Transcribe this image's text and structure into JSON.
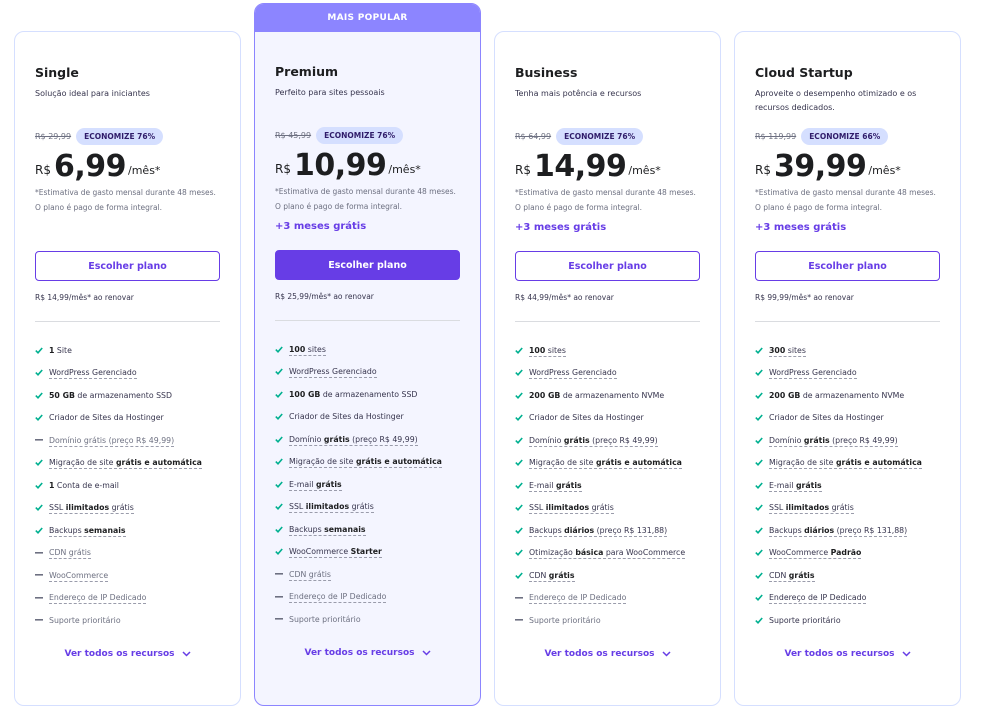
{
  "popular_banner": "MAIS POPULAR",
  "choose_label": "Escolher plano",
  "see_all_label": "Ver todos os recursos",
  "colors": {
    "accent": "#673de6",
    "popular": "#8c85ff",
    "check": "#00b090",
    "dash": "#6d7081",
    "badge": "#d5dfff"
  },
  "plans": [
    {
      "name": "Single",
      "desc": "Solução ideal para iniciantes",
      "old_price": "R$ 29,99",
      "badge": "ECONOMIZE 76%",
      "currency": "R$",
      "amount": "6,99",
      "period": "/mês*",
      "estimate": "*Estimativa de gasto mensal durante 48 meses. O plano é pago de forma integral.",
      "bonus": "",
      "renew": "R$ 14,99/mês* ao renovar",
      "features": [
        {
          "icon": "check",
          "bold": "1",
          "text": " Site",
          "dotted": false
        },
        {
          "icon": "check",
          "text": "WordPress Gerenciado",
          "dotted": true
        },
        {
          "icon": "check",
          "bold": "50 GB",
          "text": " de armazenamento SSD",
          "dotted": false
        },
        {
          "icon": "check",
          "text": "Criador de Sites da Hostinger",
          "dotted": false
        },
        {
          "icon": "dash",
          "text": "Domínio grátis (preço R$ 49,99)",
          "dotted": true
        },
        {
          "icon": "check",
          "text": "Migração de site ",
          "bold_after": "grátis e automática",
          "dotted": true
        },
        {
          "icon": "check",
          "bold": "1",
          "text": " Conta de e-mail",
          "dotted": false
        },
        {
          "icon": "check",
          "text": "SSL ",
          "bold_after": "ilimitados",
          "tail": " grátis",
          "dotted": true
        },
        {
          "icon": "check",
          "text": "Backups ",
          "bold_after": "semanais",
          "dotted": true
        },
        {
          "icon": "dash",
          "text": "CDN grátis",
          "dotted": true
        },
        {
          "icon": "dash",
          "text": "WooCommerce",
          "dotted": true
        },
        {
          "icon": "dash",
          "text": "Endereço de IP Dedicado",
          "dotted": true
        },
        {
          "icon": "dash",
          "text": "Suporte prioritário",
          "dotted": false
        }
      ]
    },
    {
      "name": "Premium",
      "desc": "Perfeito para sites pessoais",
      "old_price": "R$ 45,99",
      "badge": "ECONOMIZE 76%",
      "currency": "R$",
      "amount": "10,99",
      "period": "/mês*",
      "estimate": "*Estimativa de gasto mensal durante 48 meses. O plano é pago de forma integral.",
      "bonus": "+3 meses grátis",
      "renew": "R$ 25,99/mês* ao renovar",
      "features": [
        {
          "icon": "check",
          "bold": "100",
          "text": " sites",
          "dotted": true
        },
        {
          "icon": "check",
          "text": "WordPress Gerenciado",
          "dotted": true
        },
        {
          "icon": "check",
          "bold": "100 GB",
          "text": " de armazenamento SSD",
          "dotted": false
        },
        {
          "icon": "check",
          "text": "Criador de Sites da Hostinger",
          "dotted": false
        },
        {
          "icon": "check",
          "text": "Domínio ",
          "bold_after": "grátis",
          "tail": " (preço R$ 49,99)",
          "dotted": true
        },
        {
          "icon": "check",
          "text": "Migração de site ",
          "bold_after": "grátis e automática",
          "dotted": true
        },
        {
          "icon": "check",
          "text": "E-mail ",
          "bold_after": "grátis",
          "dotted": true
        },
        {
          "icon": "check",
          "text": "SSL ",
          "bold_after": "ilimitados",
          "tail": " grátis",
          "dotted": true
        },
        {
          "icon": "check",
          "text": "Backups ",
          "bold_after": "semanais",
          "dotted": true
        },
        {
          "icon": "check",
          "text": "WooCommerce ",
          "bold_after": "Starter",
          "dotted": true
        },
        {
          "icon": "dash",
          "text": "CDN grátis",
          "dotted": true
        },
        {
          "icon": "dash",
          "text": "Endereço de IP Dedicado",
          "dotted": true
        },
        {
          "icon": "dash",
          "text": "Suporte prioritário",
          "dotted": false
        }
      ]
    },
    {
      "name": "Business",
      "desc": "Tenha mais potência e recursos",
      "old_price": "R$ 64,99",
      "badge": "ECONOMIZE 76%",
      "currency": "R$",
      "amount": "14,99",
      "period": "/mês*",
      "estimate": "*Estimativa de gasto mensal durante 48 meses. O plano é pago de forma integral.",
      "bonus": "+3 meses grátis",
      "renew": "R$ 44,99/mês* ao renovar",
      "features": [
        {
          "icon": "check",
          "bold": "100",
          "text": " sites",
          "dotted": true
        },
        {
          "icon": "check",
          "text": "WordPress Gerenciado",
          "dotted": true
        },
        {
          "icon": "check",
          "bold": "200 GB",
          "text": " de armazenamento NVMe",
          "dotted": false
        },
        {
          "icon": "check",
          "text": "Criador de Sites da Hostinger",
          "dotted": false
        },
        {
          "icon": "check",
          "text": "Domínio ",
          "bold_after": "grátis",
          "tail": " (preço R$ 49,99)",
          "dotted": true
        },
        {
          "icon": "check",
          "text": "Migração de site ",
          "bold_after": "grátis e automática",
          "dotted": true
        },
        {
          "icon": "check",
          "text": "E-mail ",
          "bold_after": "grátis",
          "dotted": true
        },
        {
          "icon": "check",
          "text": "SSL ",
          "bold_after": "ilimitados",
          "tail": " grátis",
          "dotted": true
        },
        {
          "icon": "check",
          "text": "Backups ",
          "bold_after": "diários",
          "tail": " (preço R$ 131,88)",
          "dotted": true
        },
        {
          "icon": "check",
          "text": "Otimização ",
          "bold_after": "básica",
          "tail": " para WooCommerce",
          "dotted": true
        },
        {
          "icon": "check",
          "text": "CDN ",
          "bold_after": "grátis",
          "dotted": true
        },
        {
          "icon": "dash",
          "text": "Endereço de IP Dedicado",
          "dotted": true
        },
        {
          "icon": "dash",
          "text": "Suporte prioritário",
          "dotted": false
        }
      ]
    },
    {
      "name": "Cloud Startup",
      "desc": "Aproveite o desempenho otimizado e os recursos dedicados.",
      "old_price": "R$ 119,99",
      "badge": "ECONOMIZE 66%",
      "currency": "R$",
      "amount": "39,99",
      "period": "/mês*",
      "estimate": "*Estimativa de gasto mensal durante 48 meses. O plano é pago de forma integral.",
      "bonus": "+3 meses grátis",
      "renew": "R$ 99,99/mês* ao renovar",
      "features": [
        {
          "icon": "check",
          "bold": "300",
          "text": " sites",
          "dotted": true
        },
        {
          "icon": "check",
          "text": "WordPress Gerenciado",
          "dotted": true
        },
        {
          "icon": "check",
          "bold": "200 GB",
          "text": " de armazenamento NVMe",
          "dotted": false
        },
        {
          "icon": "check",
          "text": "Criador de Sites da Hostinger",
          "dotted": false
        },
        {
          "icon": "check",
          "text": "Domínio ",
          "bold_after": "grátis",
          "tail": " (preço R$ 49,99)",
          "dotted": true
        },
        {
          "icon": "check",
          "text": "Migração de site ",
          "bold_after": "grátis e automática",
          "dotted": true
        },
        {
          "icon": "check",
          "text": "E-mail ",
          "bold_after": "grátis",
          "dotted": true
        },
        {
          "icon": "check",
          "text": "SSL ",
          "bold_after": "ilimitados",
          "tail": " grátis",
          "dotted": true
        },
        {
          "icon": "check",
          "text": "Backups ",
          "bold_after": "diários",
          "tail": " (preço R$ 131,88)",
          "dotted": true
        },
        {
          "icon": "check",
          "text": "WooCommerce ",
          "bold_after": "Padrão",
          "dotted": true
        },
        {
          "icon": "check",
          "text": "CDN ",
          "bold_after": "grátis",
          "dotted": true
        },
        {
          "icon": "check",
          "text": "Endereço de IP Dedicado",
          "dotted": true
        },
        {
          "icon": "check",
          "text": "Suporte prioritário",
          "dotted": false
        }
      ]
    }
  ]
}
